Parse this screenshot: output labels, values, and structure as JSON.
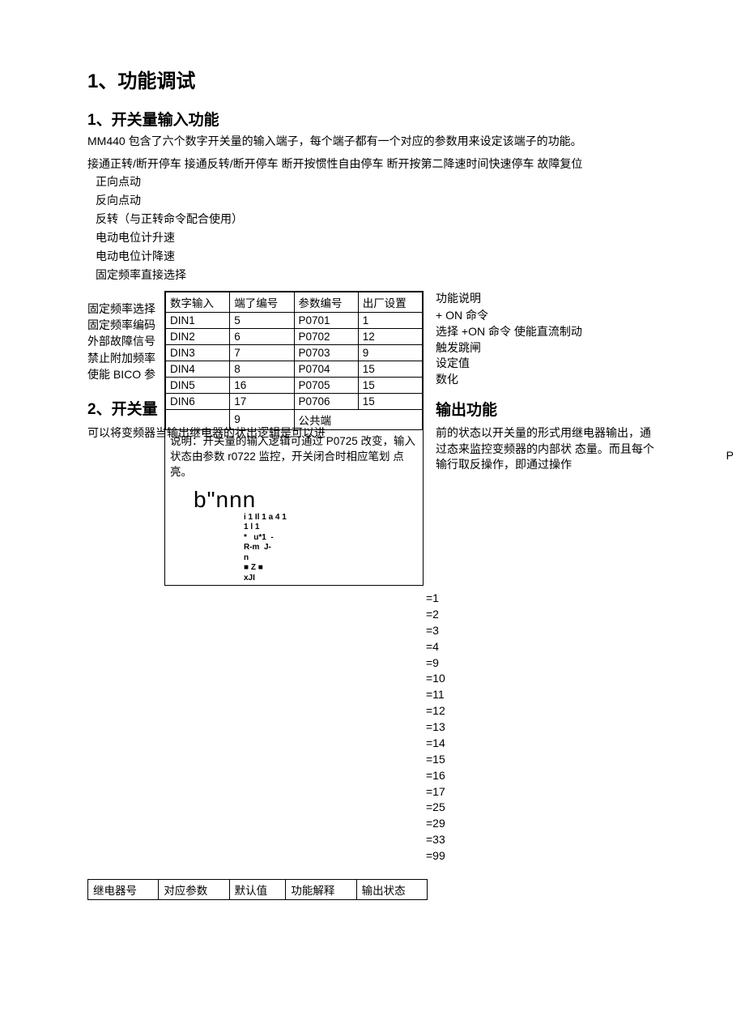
{
  "title": "1、功能调试",
  "section1": {
    "title": "1、开关量输入功能",
    "intro": "MM440 包含了六个数字开关量的输入端子，每个端子都有一个对应的参数用来设定该端子的功能。",
    "line1": "接通正转/断开停车  接通反转/断开停车  断开按惯性自由停车  断开按第二降速时间快速停车  故障复位",
    "items": [
      "正向点动",
      "反向点动",
      "反转（与正转命令配合使用）",
      "电动电位计升速",
      "电动电位计降速",
      "固定频率直接选择"
    ],
    "left_labels": [
      "固定频率选择",
      "  固定频率编码",
      "外部故障信号",
      "禁止附加频率",
      "使能 BICO 参"
    ],
    "table": {
      "headers": [
        "数字输入",
        "端了编号",
        "参数编号",
        "出厂设置"
      ],
      "rows": [
        [
          "DIN1",
          "5",
          "P0701",
          "1"
        ],
        [
          "DIN2",
          "6",
          "P0702",
          "12"
        ],
        [
          "DIN3",
          "7",
          "P0703",
          "9"
        ],
        [
          "DIN4",
          "8",
          "P0704",
          "15"
        ],
        [
          "DIN5",
          "16",
          "P0705",
          "15"
        ],
        [
          "DIN6",
          "17",
          "P0706",
          "15"
        ],
        [
          "",
          "9",
          "公共端",
          ""
        ]
      ],
      "note": "说明：开关量的输入逻辑可通过     P0725 改变，输入状态由参数 r0722 监控，开关闭合时相应笔划  点亮。",
      "graphic_big": "b\"nnn",
      "graphic_small": "i 1 Il 1 a 4 1\n1 l 1\n*   u*1  -\nR-m  J-\nn\n■ Z ■\nxJI"
    },
    "right": {
      "func_label": "功能说明",
      "lines": [
        "+ ON 命令",
        "选择  +ON 命令  使能直流制动",
        "触发跳闸",
        "设定值",
        "数化"
      ]
    }
  },
  "section2": {
    "title": "2、开关量",
    "left_text": "可以将变频器当输出继电器的状出逻辑是可以进",
    "output_title": "输出功能",
    "right_text": "前的状态以开关量的形式用继电器输出，通过态来监控变频器的内部状 态量。而且每个输行取反操作，即通过操作",
    "page_edge": "P"
  },
  "eq_values": [
    "=1",
    "=2",
    "=3",
    "=4",
    "=9",
    "=10",
    "=11",
    "=12",
    "=13",
    "=14",
    "=15",
    "=16",
    "=17",
    "=25",
    "=29",
    "=33",
    "=99"
  ],
  "bottom_headers": [
    "继电器号",
    "对应参数",
    "默认值",
    "功能解释",
    "输出状态"
  ]
}
